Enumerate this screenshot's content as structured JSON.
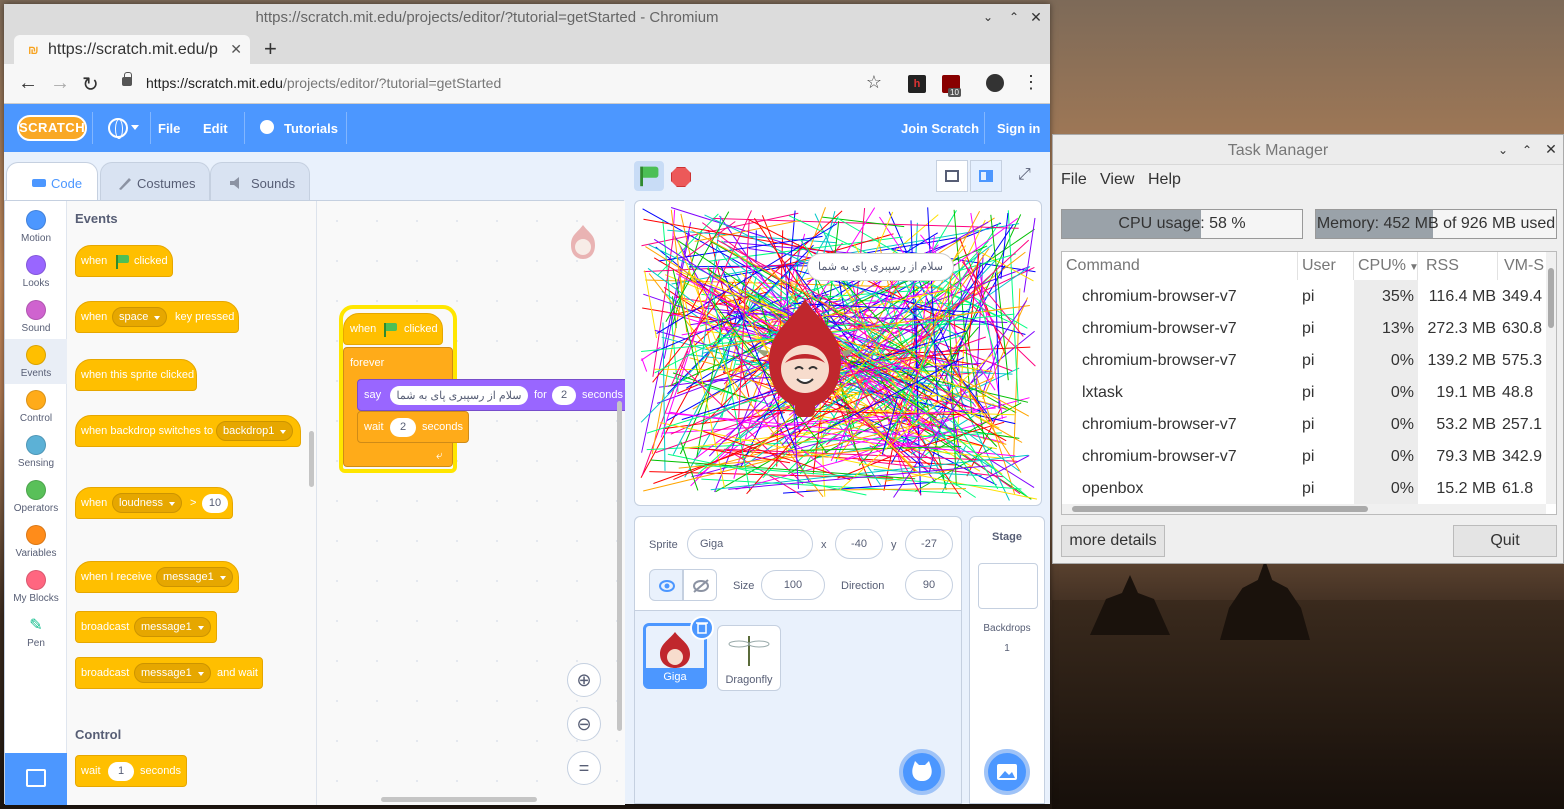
{
  "browser": {
    "window_title": "https://scratch.mit.edu/projects/editor/?tutorial=getStarted - Chromium",
    "tab_title": "https://scratch.mit.edu/p",
    "url_host": "https://scratch.mit.edu",
    "url_path": "/projects/editor/?tutorial=getStarted",
    "ext_badge": "10"
  },
  "scratch": {
    "logo": "SCRATCH",
    "menu": {
      "file": "File",
      "edit": "Edit",
      "tutorials": "Tutorials",
      "join": "Join Scratch",
      "signin": "Sign in"
    },
    "tabs": {
      "code": "Code",
      "costumes": "Costumes",
      "sounds": "Sounds"
    },
    "categories": [
      {
        "label": "Motion",
        "color": "#4c97ff"
      },
      {
        "label": "Looks",
        "color": "#9966ff"
      },
      {
        "label": "Sound",
        "color": "#cf63cf"
      },
      {
        "label": "Events",
        "color": "#ffbf00"
      },
      {
        "label": "Control",
        "color": "#ffab19"
      },
      {
        "label": "Sensing",
        "color": "#5cb1d6"
      },
      {
        "label": "Operators",
        "color": "#59c059"
      },
      {
        "label": "Variables",
        "color": "#ff8c1a"
      },
      {
        "label": "My Blocks",
        "color": "#ff6680"
      },
      {
        "label": "Pen",
        "color": "#0fbd8c"
      }
    ],
    "palette": {
      "events_heading": "Events",
      "control_heading": "Control",
      "b_when": "when",
      "b_clicked": "clicked",
      "b_space": "space",
      "b_key_pressed": "key pressed",
      "b_sprite_clicked": "when this sprite clicked",
      "b_backdrop_switches": "when backdrop switches to",
      "b_backdrop1": "backdrop1",
      "b_loudness": "loudness",
      "b_gt": ">",
      "b_loudness_val": "10",
      "b_when_receive": "when I receive",
      "b_message1": "message1",
      "b_broadcast": "broadcast",
      "b_and_wait": "and wait",
      "b_wait": "wait",
      "b_wait_val": "1",
      "b_seconds": "seconds"
    },
    "script": {
      "when": "when",
      "clicked": "clicked",
      "forever": "forever",
      "say": "say",
      "say_text": "سلام از رسپبری پای به شما",
      "for": "for",
      "say_secs": "2",
      "seconds": "seconds",
      "wait": "wait",
      "wait_secs": "2",
      "wait_seconds": "seconds"
    },
    "stage": {
      "bubble": "سلام از رسپبری پای به شما"
    },
    "sprite_info": {
      "sprite_label": "Sprite",
      "sprite_name": "Giga",
      "x_label": "x",
      "x": "-40",
      "y_label": "y",
      "y": "-27",
      "size_label": "Size",
      "size": "100",
      "direction_label": "Direction",
      "direction": "90"
    },
    "sprites": [
      {
        "name": "Giga"
      },
      {
        "name": "Dragonfly"
      }
    ],
    "stage_pane": {
      "title": "Stage",
      "backdrops_label": "Backdrops",
      "backdrops_count": "1"
    }
  },
  "taskmgr": {
    "title": "Task Manager",
    "menu": {
      "file": "File",
      "view": "View",
      "help": "Help"
    },
    "cpu_text": "CPU usage: 58 %",
    "cpu_fraction": 0.58,
    "mem_text": "Memory: 452 MB of 926 MB used",
    "mem_fraction": 0.488,
    "columns": {
      "command": "Command",
      "user": "User",
      "cpu": "CPU%",
      "rss": "RSS",
      "vms": "VM-S"
    },
    "rows": [
      {
        "command": "chromium-browser-v7",
        "user": "pi",
        "cpu": "35%",
        "rss": "116.4 MB",
        "vms": "349.4"
      },
      {
        "command": "chromium-browser-v7",
        "user": "pi",
        "cpu": "13%",
        "rss": "272.3 MB",
        "vms": "630.8"
      },
      {
        "command": "chromium-browser-v7",
        "user": "pi",
        "cpu": "0%",
        "rss": "139.2 MB",
        "vms": "575.3"
      },
      {
        "command": "lxtask",
        "user": "pi",
        "cpu": "0%",
        "rss": "19.1 MB",
        "vms": "48.8"
      },
      {
        "command": "chromium-browser-v7",
        "user": "pi",
        "cpu": "0%",
        "rss": "53.2 MB",
        "vms": "257.1"
      },
      {
        "command": "chromium-browser-v7",
        "user": "pi",
        "cpu": "0%",
        "rss": "79.3 MB",
        "vms": "342.9"
      },
      {
        "command": "openbox",
        "user": "pi",
        "cpu": "0%",
        "rss": "15.2 MB",
        "vms": "61.8"
      }
    ],
    "more_details": "more details",
    "quit": "Quit"
  }
}
